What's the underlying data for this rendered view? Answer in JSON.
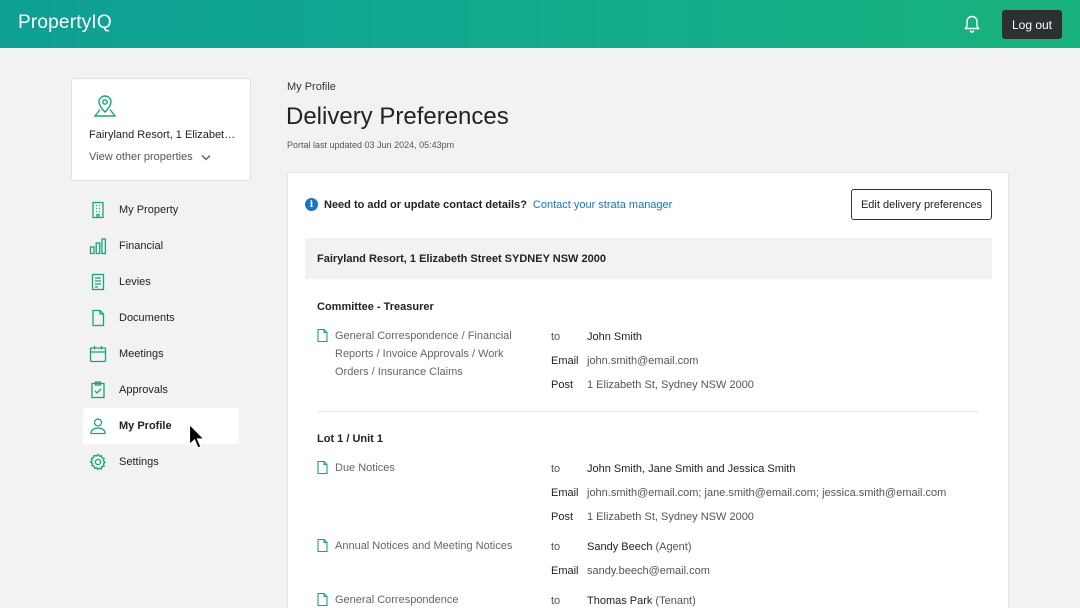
{
  "header": {
    "logo": "PropertyIQ",
    "logout_label": "Log out"
  },
  "property_card": {
    "name": "Fairyland Resort, 1 Elizabeth…",
    "view_other": "View other properties"
  },
  "sidebar": {
    "items": [
      {
        "label": "My Property",
        "icon": "building-icon"
      },
      {
        "label": "Financial",
        "icon": "bar-chart-icon"
      },
      {
        "label": "Levies",
        "icon": "receipt-icon"
      },
      {
        "label": "Documents",
        "icon": "document-icon"
      },
      {
        "label": "Meetings",
        "icon": "calendar-icon"
      },
      {
        "label": "Approvals",
        "icon": "clipboard-check-icon"
      },
      {
        "label": "My Profile",
        "icon": "user-icon",
        "active": true
      },
      {
        "label": "Settings",
        "icon": "gear-icon"
      }
    ]
  },
  "main": {
    "breadcrumb": "My Profile",
    "title": "Delivery Preferences",
    "updated": "Portal last updated 03 Jun 2024, 05:43pm"
  },
  "panel": {
    "info_question": "Need to add or update contact details?",
    "info_link": "Contact your strata manager",
    "edit_button": "Edit delivery preferences",
    "address": "Fairyland Resort, 1 Elizabeth Street SYDNEY NSW 2000",
    "sections": [
      {
        "heading": "Committee - Treasurer",
        "items": [
          {
            "label": "General Correspondence / Financial Reports / Invoice Approvals / Work Orders / Insurance Claims",
            "to": "John Smith",
            "email": "john.smith@email.com",
            "post": "1 Elizabeth St, Sydney NSW 2000"
          }
        ]
      },
      {
        "heading": "Lot 1 / Unit 1",
        "items": [
          {
            "label": "Due Notices",
            "to": "John Smith, Jane Smith and Jessica Smith",
            "email": "john.smith@email.com; jane.smith@email.com; jessica.smith@email.com",
            "post": "1 Elizabeth St, Sydney NSW 2000"
          },
          {
            "label": "Annual Notices and Meeting Notices",
            "to": "Sandy Beech",
            "to_role": "(Agent)",
            "email": "sandy.beech@email.com"
          },
          {
            "label": "General Correspondence",
            "to": "Thomas Park",
            "to_role": "(Tenant)"
          }
        ]
      }
    ],
    "keys": {
      "to": "to",
      "email": "Email",
      "post": "Post"
    }
  },
  "colors": {
    "header_start": "#0f9f94",
    "header_end": "#19b27c",
    "accent_green": "#1aa37a",
    "link_blue": "#1a73c4",
    "button_dark": "#2d3033"
  }
}
